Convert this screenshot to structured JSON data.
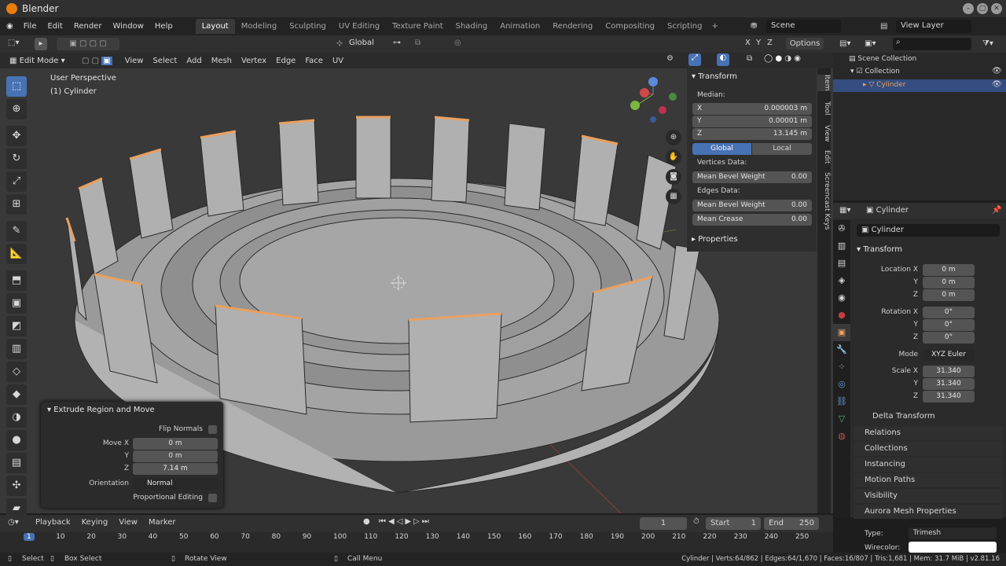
{
  "app": {
    "title": "Blender"
  },
  "menu": [
    "File",
    "Edit",
    "Render",
    "Window",
    "Help"
  ],
  "workspaces": [
    "Layout",
    "Modeling",
    "Sculpting",
    "UV Editing",
    "Texture Paint",
    "Shading",
    "Animation",
    "Rendering",
    "Compositing",
    "Scripting"
  ],
  "scene": {
    "name": "Scene",
    "view_layer": "View Layer"
  },
  "viewport_header": {
    "orientation": "Global",
    "axes": [
      "X",
      "Y",
      "Z"
    ],
    "options": "Options"
  },
  "mode_bar": {
    "mode": "Edit Mode",
    "items": [
      "View",
      "Select",
      "Add",
      "Mesh",
      "Vertex",
      "Edge",
      "Face",
      "UV"
    ]
  },
  "viewport": {
    "perspective": "User Perspective",
    "object": "(1) Cylinder"
  },
  "tools": [
    {
      "icon": "select-box-icon",
      "glyph": "⬚",
      "active": true
    },
    {
      "icon": "cursor-icon",
      "glyph": "⊕",
      "active": false
    },
    {
      "icon": "move-icon",
      "glyph": "✥",
      "active": false
    },
    {
      "icon": "rotate-icon",
      "glyph": "↻",
      "active": false
    },
    {
      "icon": "scale-icon",
      "glyph": "⤢",
      "active": false
    },
    {
      "icon": "transform-icon",
      "glyph": "⊞",
      "active": false
    },
    {
      "icon": "annotate-icon",
      "glyph": "✎",
      "active": false
    },
    {
      "icon": "measure-icon",
      "glyph": "📐",
      "active": false
    },
    {
      "icon": "extrude-icon",
      "glyph": "⬒",
      "active": false
    },
    {
      "icon": "inset-icon",
      "glyph": "▣",
      "active": false
    },
    {
      "icon": "bevel-icon",
      "glyph": "◩",
      "active": false
    },
    {
      "icon": "loop-cut-icon",
      "glyph": "▥",
      "active": false
    },
    {
      "icon": "knife-icon",
      "glyph": "◇",
      "active": false
    },
    {
      "icon": "poly-build-icon",
      "glyph": "◆",
      "active": false
    },
    {
      "icon": "spin-icon",
      "glyph": "◑",
      "active": false
    },
    {
      "icon": "smooth-icon",
      "glyph": "●",
      "active": false
    },
    {
      "icon": "edge-slide-icon",
      "glyph": "▤",
      "active": false
    },
    {
      "icon": "shrink-icon",
      "glyph": "✣",
      "active": false
    },
    {
      "icon": "shear-icon",
      "glyph": "▰",
      "active": false
    }
  ],
  "npanel": {
    "title": "Transform",
    "median": "Median:",
    "x": {
      "label": "X",
      "value": "0.000003 m"
    },
    "y": {
      "label": "Y",
      "value": "0.00001 m"
    },
    "z": {
      "label": "Z",
      "value": "13.145 m"
    },
    "global": "Global",
    "local": "Local",
    "vertices_data": "Vertices Data:",
    "v_bevel": {
      "label": "Mean Bevel Weight",
      "value": "0.00"
    },
    "edges_data": "Edges Data:",
    "e_bevel": {
      "label": "Mean Bevel Weight",
      "value": "0.00"
    },
    "crease": {
      "label": "Mean Crease",
      "value": "0.00"
    },
    "properties": "Properties",
    "tabs": [
      "Item",
      "Tool",
      "View",
      "Edit",
      "Screencast Keys"
    ]
  },
  "operator_panel": {
    "title": "Extrude Region and Move",
    "flip_normals": "Flip Normals",
    "move_x": {
      "label": "Move X",
      "value": "0 m"
    },
    "move_y": {
      "label": "Y",
      "value": "0 m"
    },
    "move_z": {
      "label": "Z",
      "value": "7.14 m"
    },
    "orientation": {
      "label": "Orientation",
      "value": "Normal"
    },
    "proportional": "Proportional Editing"
  },
  "outliner": {
    "scene_collection": "Scene Collection",
    "collection": "Collection",
    "object": "Cylinder"
  },
  "properties": {
    "object": "Cylinder",
    "name_field": "Cylinder",
    "transform": "Transform",
    "location": {
      "label": "Location X",
      "x": "0 m",
      "y": "0 m",
      "z": "0 m"
    },
    "rotation": {
      "label": "Rotation X",
      "x": "0°",
      "y": "0°",
      "z": "0°"
    },
    "mode": {
      "label": "Mode",
      "value": "XYZ Euler"
    },
    "scale": {
      "label": "Scale X",
      "x": "31.340",
      "y": "31.340",
      "z": "31.340"
    },
    "y_label": "Y",
    "z_label": "Z",
    "sections": [
      "Delta Transform",
      "Relations",
      "Collections",
      "Instancing",
      "Motion Paths",
      "Visibility",
      "Aurora Mesh Properties"
    ],
    "type": {
      "label": "Type:",
      "value": "Trimesh"
    },
    "wirecolor": "Wirecolor:"
  },
  "timeline": {
    "menu": [
      "Playback",
      "Keying",
      "View",
      "Marker"
    ],
    "current_frame": "1",
    "start": {
      "label": "Start",
      "value": "1"
    },
    "end": {
      "label": "End",
      "value": "250"
    },
    "ticks": [
      "1",
      "10",
      "20",
      "30",
      "40",
      "50",
      "60",
      "70",
      "80",
      "90",
      "100",
      "110",
      "120",
      "130",
      "140",
      "150",
      "160",
      "170",
      "180",
      "190",
      "200",
      "210",
      "220",
      "230",
      "240",
      "250"
    ]
  },
  "status": {
    "select": "Select",
    "box_select": "Box Select",
    "rotate_view": "Rotate View",
    "call_menu": "Call Menu",
    "stats": "Cylinder | Verts:64/862 | Edges:64/1,670 | Faces:16/807 | Tris:1,681 | Mem: 31.7 MiB | v2.81.16"
  },
  "colors": {
    "accent": "#4772b3",
    "selected_edge": "#e8a060",
    "mesh": "#a8a8a8",
    "viewport_bg": "#393939"
  }
}
